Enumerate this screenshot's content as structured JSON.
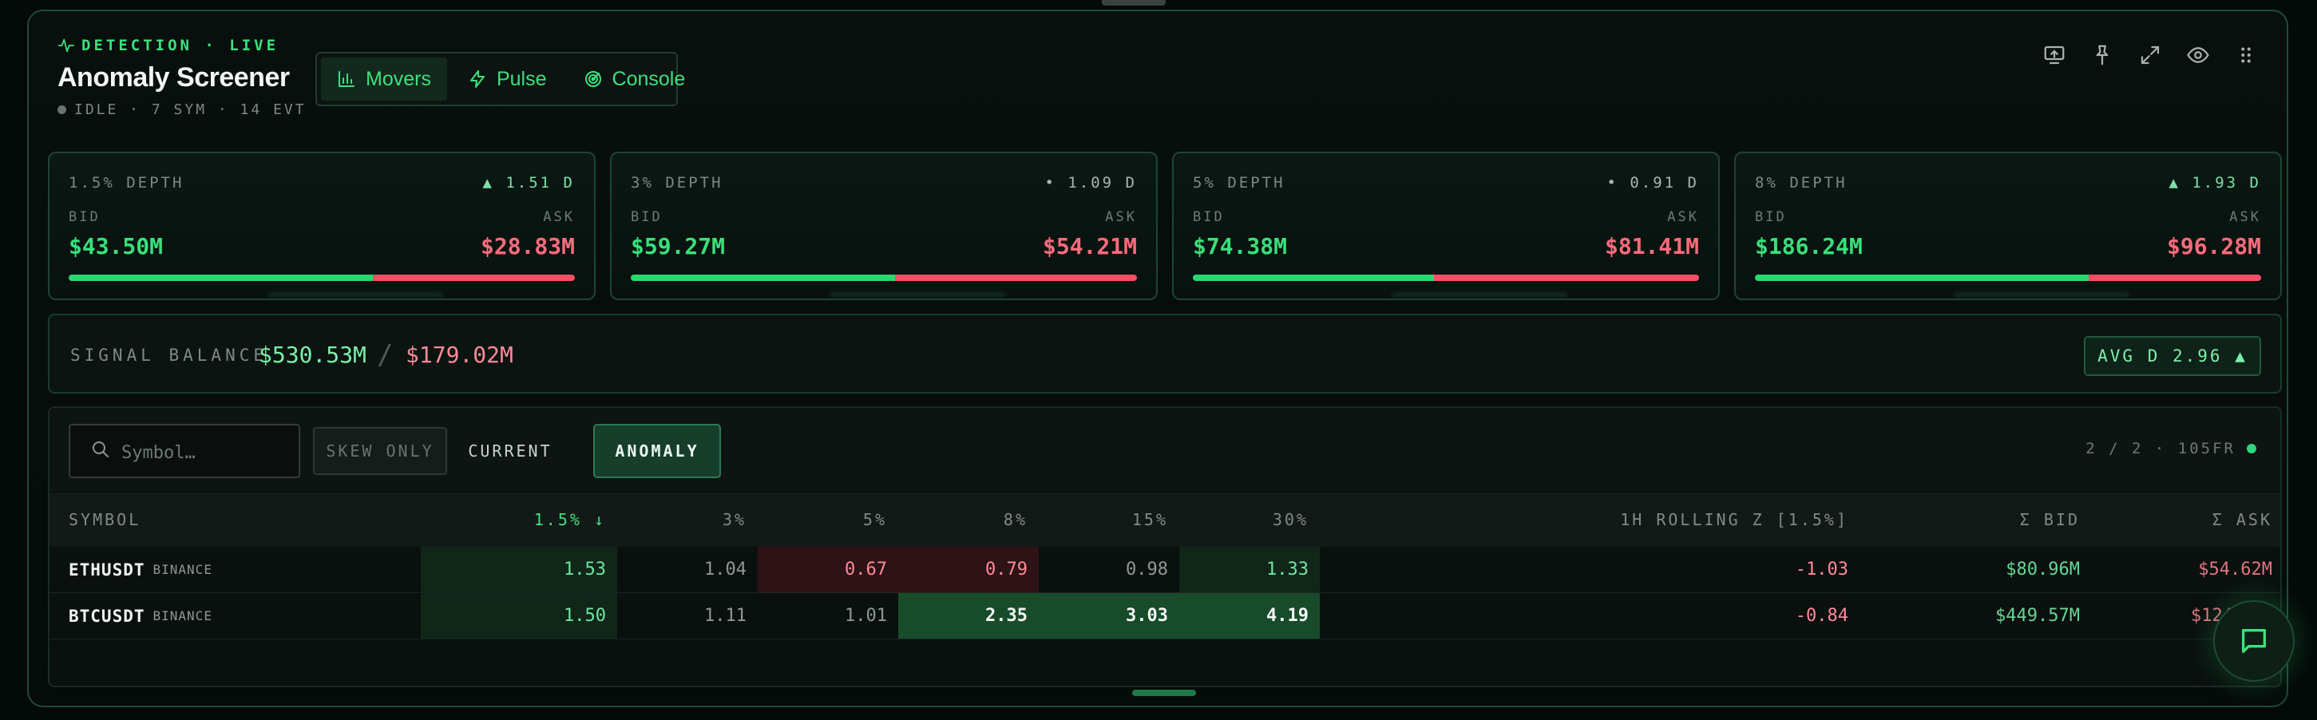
{
  "header": {
    "eyebrow": "DETECTION · LIVE",
    "title": "Anomaly Screener",
    "status": "IDLE · 7 SYM · 14 EVT"
  },
  "tabs": [
    {
      "label": "Movers",
      "icon": "bar-chart-icon",
      "active": true
    },
    {
      "label": "Pulse",
      "icon": "lightning-icon",
      "active": false
    },
    {
      "label": "Console",
      "icon": "radar-icon",
      "active": false
    }
  ],
  "toolbar": [
    "cast-icon",
    "pin-icon",
    "expand-icon",
    "eye-icon",
    "drag-handle-icon"
  ],
  "depth_cards": [
    {
      "label": "1.5% DEPTH",
      "delta": "▲ 1.51 D",
      "delta_dir": "up",
      "bid_label": "BID",
      "ask_label": "ASK",
      "bid": "$43.50M",
      "ask": "$28.83M",
      "bid_share": 0.601
    },
    {
      "label": "3% DEPTH",
      "delta": "• 1.09 D",
      "delta_dir": "neutral",
      "bid_label": "BID",
      "ask_label": "ASK",
      "bid": "$59.27M",
      "ask": "$54.21M",
      "bid_share": 0.522
    },
    {
      "label": "5% DEPTH",
      "delta": "• 0.91 D",
      "delta_dir": "neutral",
      "bid_label": "BID",
      "ask_label": "ASK",
      "bid": "$74.38M",
      "ask": "$81.41M",
      "bid_share": 0.477
    },
    {
      "label": "8% DEPTH",
      "delta": "▲ 1.93 D",
      "delta_dir": "up",
      "bid_label": "BID",
      "ask_label": "ASK",
      "bid": "$186.24M",
      "ask": "$96.28M",
      "bid_share": 0.659
    }
  ],
  "balance": {
    "label": "SIGNAL BALANCE",
    "bid": "$530.53M",
    "separator": "/",
    "ask": "$179.02M",
    "avg": "AVG D 2.96 ▲"
  },
  "filters": {
    "search_placeholder": "Symbol…",
    "skew_only": "SKEW ONLY",
    "current": "CURRENT",
    "anomaly": "ANOMALY",
    "page_info": "2 / 2 · 105FR"
  },
  "table": {
    "headers": [
      "SYMBOL",
      "1.5% ↓",
      "3%",
      "5%",
      "8%",
      "15%",
      "30%",
      "1H ROLLING Z [1.5%]",
      "Σ BID",
      "Σ ASK"
    ],
    "rows": [
      {
        "symbol": "ETHUSDT",
        "exchange": "BINANCE",
        "d15": "1.53",
        "d3": "1.04",
        "d5": "0.67",
        "d8": "0.79",
        "d15b": "0.98",
        "d30": "1.33",
        "z": "-1.03",
        "bid": "$80.96M",
        "ask": "$54.62M"
      },
      {
        "symbol": "BTCUSDT",
        "exchange": "BINANCE",
        "d15": "1.50",
        "d3": "1.11",
        "d5": "1.01",
        "d8": "2.35",
        "d15b": "3.03",
        "d30": "4.19",
        "z": "-0.84",
        "bid": "$449.57M",
        "ask": "$124"
      }
    ]
  },
  "colors": {
    "accent": "#3ee07c",
    "bid": "#39e07a",
    "ask": "#ff6b7d"
  }
}
